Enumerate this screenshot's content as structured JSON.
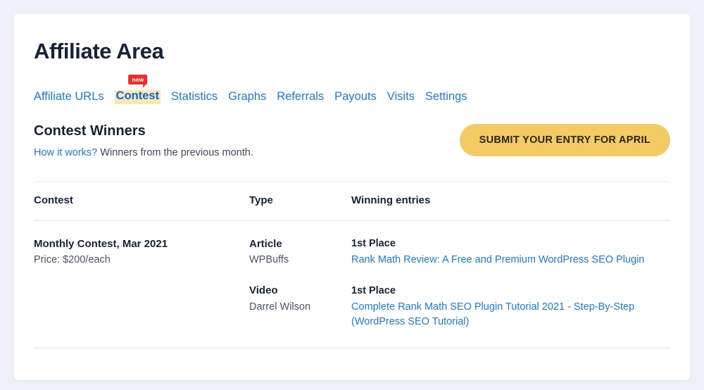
{
  "header": {
    "title": "Affiliate Area"
  },
  "nav": {
    "items": [
      {
        "label": "Affiliate URLs",
        "active": false
      },
      {
        "label": "Contest",
        "active": true,
        "badge": "new"
      },
      {
        "label": "Statistics",
        "active": false
      },
      {
        "label": "Graphs",
        "active": false
      },
      {
        "label": "Referrals",
        "active": false
      },
      {
        "label": "Payouts",
        "active": false
      },
      {
        "label": "Visits",
        "active": false
      },
      {
        "label": "Settings",
        "active": false
      }
    ]
  },
  "section": {
    "heading": "Contest Winners",
    "sub_link": "How it works?",
    "sub_text": "Winners from the previous month.",
    "submit_button": "SUBMIT YOUR ENTRY FOR APRIL"
  },
  "table": {
    "headers": {
      "contest": "Contest",
      "type": "Type",
      "entries": "Winning entries"
    },
    "rows": [
      {
        "contest_name": "Monthly Contest, Mar 2021",
        "contest_price": "Price: $200/each",
        "types": [
          {
            "label": "Article",
            "author": "WPBuffs"
          },
          {
            "label": "Video",
            "author": "Darrel Wilson"
          }
        ],
        "entries": [
          {
            "place": "1st Place",
            "title": "Rank Math Review: A Free and Premium WordPress SEO Plugin"
          },
          {
            "place": "1st Place",
            "title": "Complete Rank Math SEO Plugin Tutorial 2021 - Step-By-Step (WordPress SEO Tutorial)"
          }
        ]
      }
    ]
  },
  "colors": {
    "page_background": "#eef2f8",
    "card_background": "#ffffff",
    "link_blue": "#1a7ae8",
    "heading_dark": "#152238",
    "button_amber": "#f3ca63",
    "badge_red": "#e8312a",
    "highlight_cream": "#fae7b8"
  }
}
